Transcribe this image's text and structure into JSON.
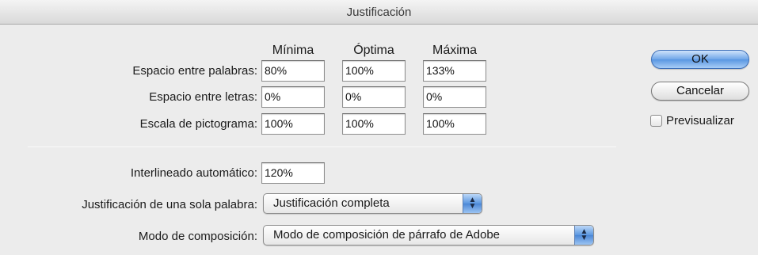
{
  "window": {
    "title": "Justificación"
  },
  "columns": [
    "Mínima",
    "Óptima",
    "Máxima"
  ],
  "rows": [
    {
      "label": "Espacio entre palabras:",
      "values": [
        "80%",
        "100%",
        "133%"
      ]
    },
    {
      "label": "Espacio entre letras:",
      "values": [
        "0%",
        "0%",
        "0%"
      ]
    },
    {
      "label": "Escala de pictograma:",
      "values": [
        "100%",
        "100%",
        "100%"
      ]
    }
  ],
  "auto_leading": {
    "label": "Interlineado automático:",
    "value": "120%"
  },
  "single_word": {
    "label": "Justificación de una sola palabra:",
    "value": "Justificación completa"
  },
  "composer": {
    "label": "Modo de composición:",
    "value": "Modo de composición de párrafo de Adobe"
  },
  "buttons": {
    "ok": "OK",
    "cancel": "Cancelar"
  },
  "preview": {
    "label": "Previsualizar",
    "checked": false
  },
  "icons": {
    "popup_arrows": "updown-arrows-icon"
  }
}
